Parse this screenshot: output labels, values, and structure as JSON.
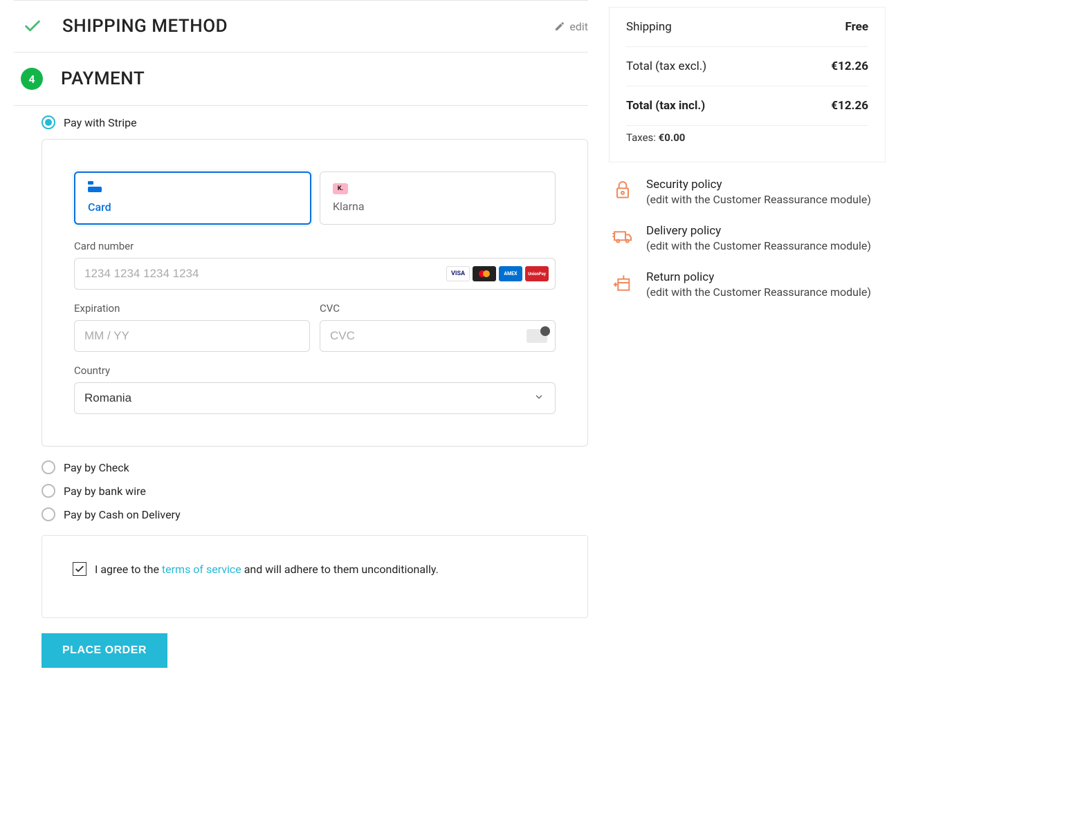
{
  "shipping_section": {
    "title": "SHIPPING METHOD",
    "edit_label": "edit"
  },
  "payment_section": {
    "step_number": "4",
    "title": "PAYMENT"
  },
  "payment_options": {
    "stripe": "Pay with Stripe",
    "check": "Pay by Check",
    "bank_wire": "Pay by bank wire",
    "cod": "Pay by Cash on Delivery"
  },
  "stripe_form": {
    "tab_card": "Card",
    "tab_klarna": "Klarna",
    "klarna_badge": "K.",
    "card_number_label": "Card number",
    "card_number_placeholder": "1234 1234 1234 1234",
    "expiration_label": "Expiration",
    "expiration_placeholder": "MM / YY",
    "cvc_label": "CVC",
    "cvc_placeholder": "CVC",
    "country_label": "Country",
    "country_value": "Romania",
    "brands": {
      "visa": "VISA",
      "amex": "AMEX",
      "unionpay": "UnionPay"
    }
  },
  "terms": {
    "prefix": "I agree to the ",
    "link": "terms of service",
    "suffix": " and will adhere to them unconditionally."
  },
  "place_order": "PLACE ORDER",
  "summary": {
    "shipping_label": "Shipping",
    "shipping_value": "Free",
    "total_excl_label": "Total (tax excl.)",
    "total_excl_value": "€12.26",
    "total_incl_label": "Total (tax incl.)",
    "total_incl_value": "€12.26",
    "taxes_label": "Taxes: ",
    "taxes_value": "€0.00"
  },
  "policies": {
    "security_title": "Security policy",
    "security_sub": "(edit with the Customer Reassurance module)",
    "delivery_title": "Delivery policy",
    "delivery_sub": "(edit with the Customer Reassurance module)",
    "return_title": "Return policy",
    "return_sub": "(edit with the Customer Reassurance module)"
  }
}
